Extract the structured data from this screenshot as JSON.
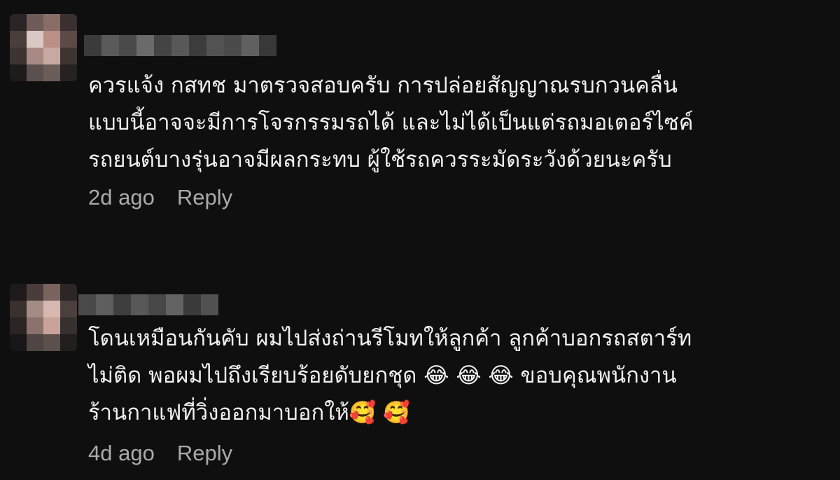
{
  "comments": [
    {
      "avatar_colors": [
        "#2a2424",
        "#6f5b57",
        "#8a6d67",
        "#3a3030",
        "#4a3e3c",
        "#d9c8c4",
        "#b98f86",
        "#5b4a46",
        "#3c3432",
        "#a88a84",
        "#c7a9a2",
        "#3e3432",
        "#1f1b1b",
        "#5a504e",
        "#6b5e5a",
        "#262222"
      ],
      "username_blur_colors": [
        "#3b3b3b",
        "#5a5a5a",
        "#4a4a4a",
        "#6a6a6a",
        "#444444",
        "#585858",
        "#3c3c3c",
        "#525252",
        "#4b4b4b",
        "#606060",
        "#383838"
      ],
      "text": "ควรแจ้ง กสทช มาตรวจสอบครับ การปล่อยสัญญาณรบกวนคลื่น\nแบบนี้อาจจะมีการโจรกรรมรถได้ และไม่ได้เป็นแต่รถมอเตอร์ไซค์\nรถยนต์บางรุ่นอาจมีผลกระทบ ผู้ใช้รถควรระมัดระวังด้วยนะครับ",
      "timestamp": "2d ago",
      "reply_label": "Reply"
    },
    {
      "avatar_colors": [
        "#1e1a1a",
        "#4a3c3a",
        "#7a625e",
        "#2c2626",
        "#3a302e",
        "#a38b86",
        "#d7b8b0",
        "#4c403e",
        "#2a2424",
        "#8c726c",
        "#c9a39a",
        "#36302e",
        "#181616",
        "#4e4442",
        "#5c504c",
        "#221e1e"
      ],
      "username_blur_colors": [
        "#4a4a4a",
        "#5e5e5e",
        "#3e3e3e",
        "#585858",
        "#474747",
        "#636363",
        "#3a3a3a",
        "#515151"
      ],
      "text": "โดนเหมือนกันคับ ผมไปส่งถ่านรีโมทให้ลูกค้า ลูกค้าบอกรถสตาร์ท\nไม่ติด พอผมไปถึงเรียบร้อยดับยกชุด 😂 😂 😂 ขอบคุณพนักงาน\nร้านกาแฟที่วิ่งออกมาบอกให้🥰 🥰",
      "timestamp": "4d ago",
      "reply_label": "Reply"
    }
  ]
}
